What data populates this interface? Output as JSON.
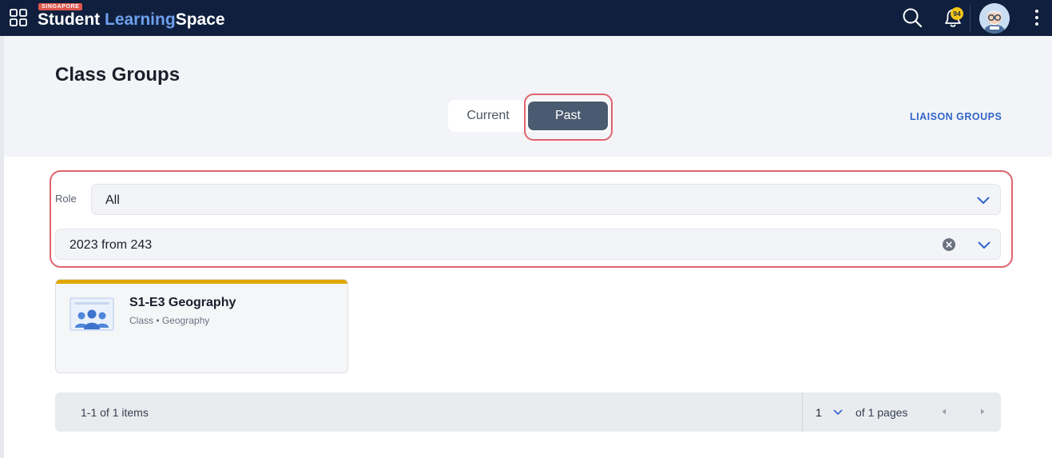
{
  "app": {
    "badge": "SINGAPORE",
    "name_part1": "Student",
    "name_part2": "Learning",
    "name_part3": "Space",
    "notification_count": "94"
  },
  "icons": {
    "apps": "grid-apps-icon",
    "search": "search-icon",
    "bell": "bell-icon",
    "avatar": "avatar-icon",
    "more": "kebab-menu-icon"
  },
  "page": {
    "title": "Class Groups",
    "toggle": {
      "current_label": "Current",
      "past_label": "Past",
      "selected": "Past"
    },
    "liaison_link": "LIAISON GROUPS"
  },
  "filters": {
    "role_label": "Role",
    "role_value": "All",
    "year_value": "2023 from 243"
  },
  "cards": [
    {
      "title": "S1-E3 Geography",
      "subtitle": "Class • Geography",
      "accent_color": "#e0a800"
    }
  ],
  "pagination": {
    "items_info": "1-1 of 1 items",
    "current_page": "1",
    "of_pages": "of 1 pages"
  },
  "colors": {
    "topbar": "#0f1f3d",
    "accent_blue": "#2f65cb",
    "toggle_selected": "#4a5a70",
    "highlight": "#e0636b"
  }
}
